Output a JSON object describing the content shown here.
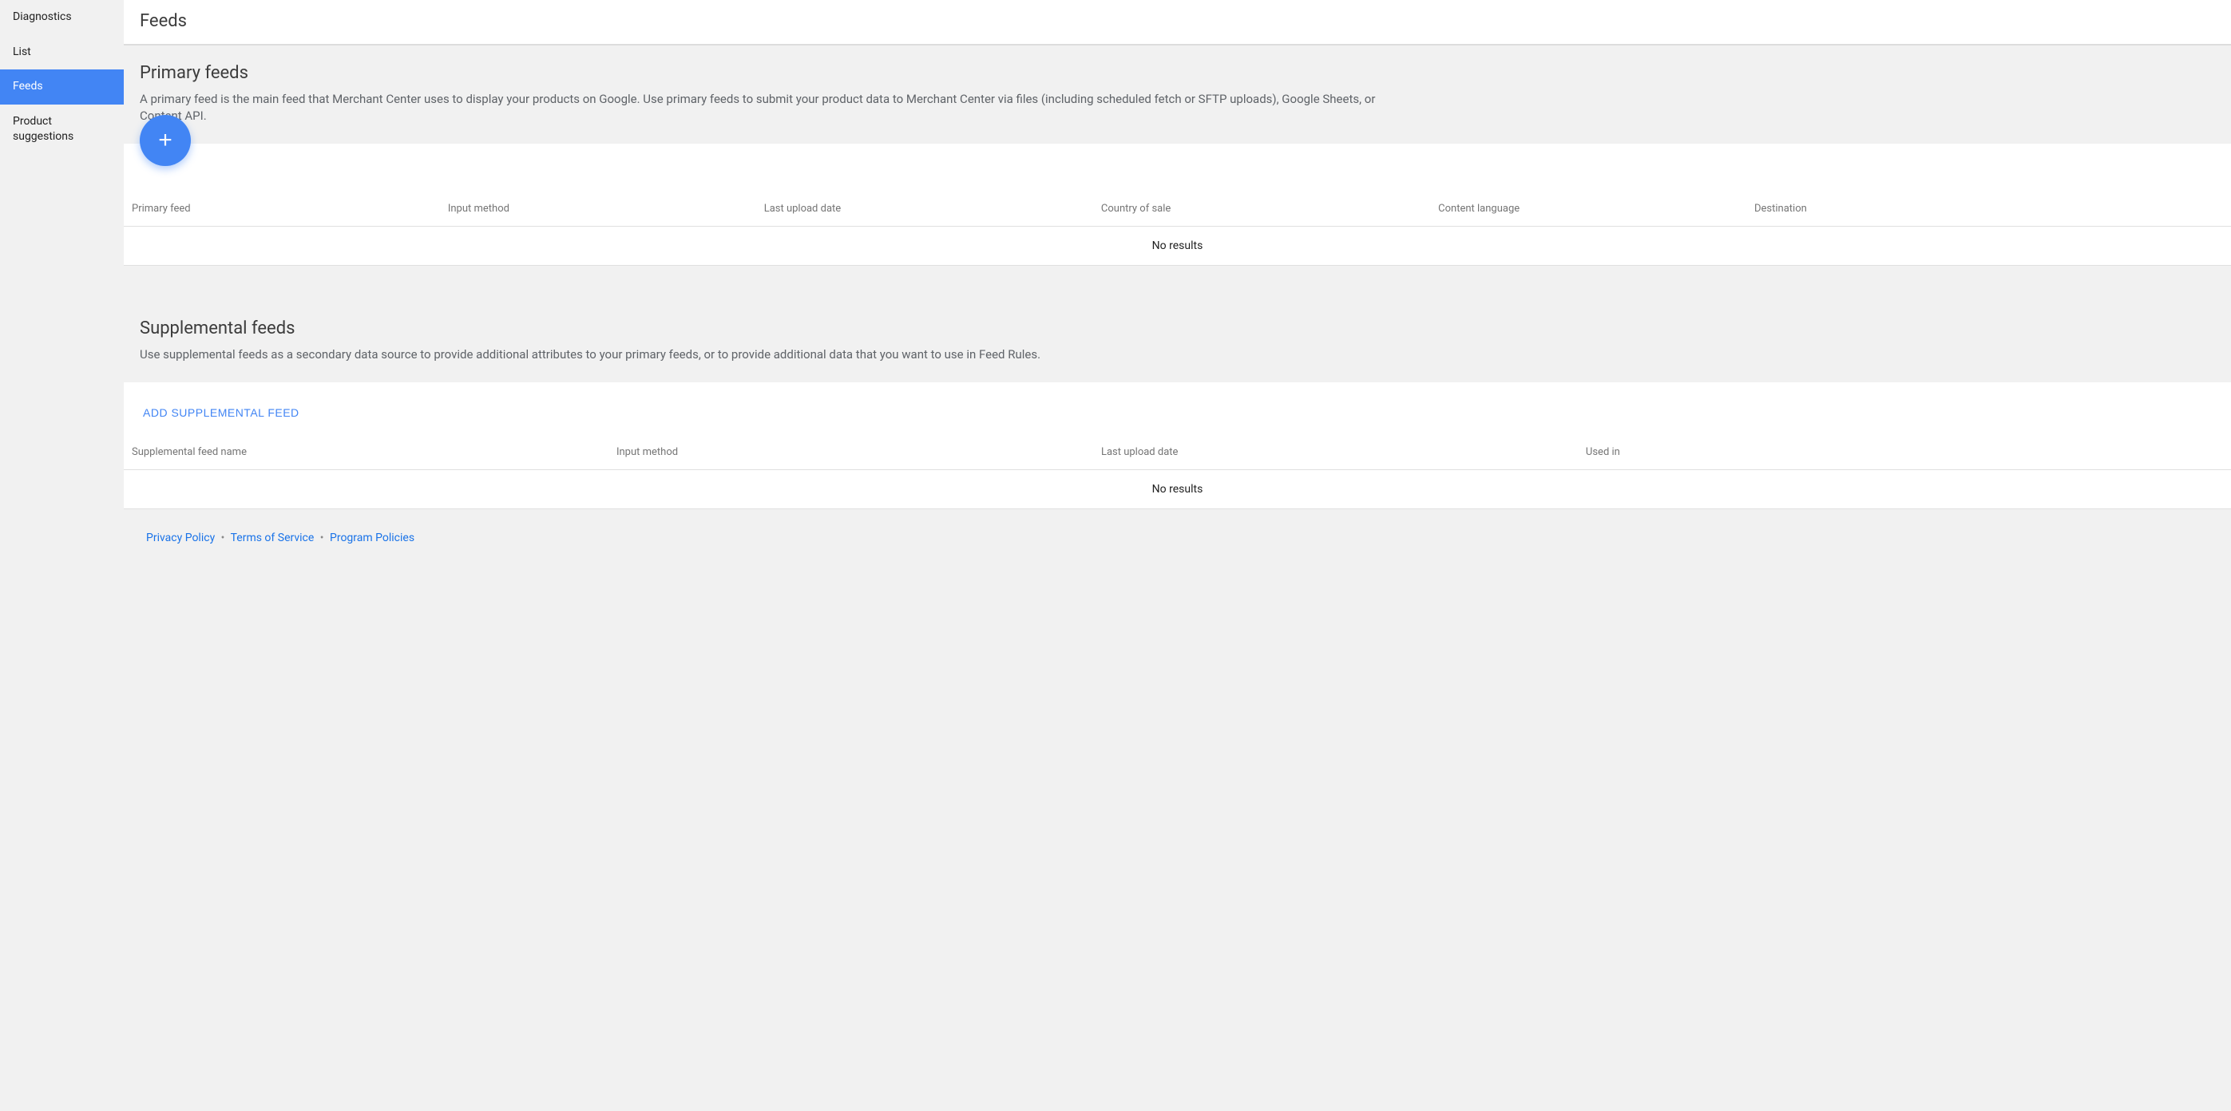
{
  "sidebar": {
    "items": [
      {
        "label": "Diagnostics",
        "active": false
      },
      {
        "label": "List",
        "active": false
      },
      {
        "label": "Feeds",
        "active": true
      },
      {
        "label": "Product suggestions",
        "active": false
      }
    ]
  },
  "header": {
    "title": "Feeds"
  },
  "primary": {
    "title": "Primary feeds",
    "description": "A primary feed is the main feed that Merchant Center uses to display your products on Google. Use primary feeds to submit your product data to Merchant Center via files (including scheduled fetch or SFTP uploads), Google Sheets, or Content API.",
    "columns": [
      "Primary feed",
      "Input method",
      "Last upload date",
      "Country of sale",
      "Content language",
      "Destination"
    ],
    "empty": "No results"
  },
  "supplemental": {
    "title": "Supplemental feeds",
    "description": "Use supplemental feeds as a secondary data source to provide additional attributes to your primary feeds, or to provide additional data that you want to use in Feed Rules.",
    "add_label": "ADD SUPPLEMENTAL FEED",
    "columns": [
      "Supplemental feed name",
      "Input method",
      "Last upload date",
      "Used in"
    ],
    "empty": "No results"
  },
  "footer": {
    "privacy": "Privacy Policy",
    "terms": "Terms of Service",
    "program": "Program Policies"
  }
}
